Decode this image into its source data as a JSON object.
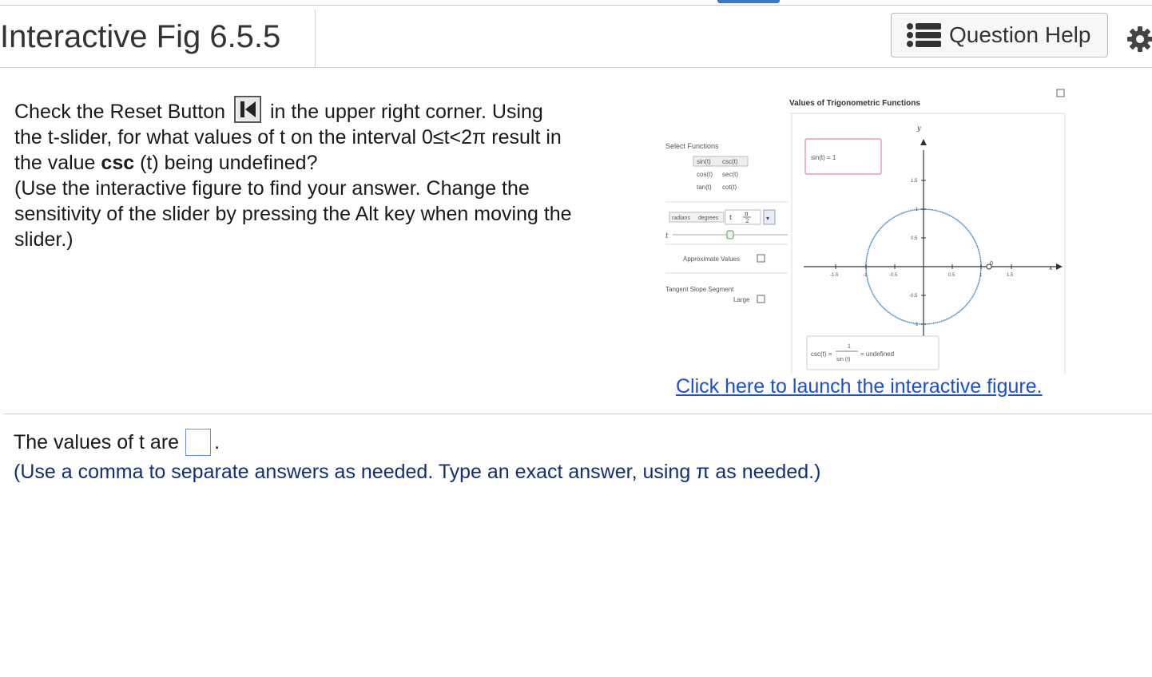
{
  "header": {
    "title": "Interactive Fig 6.5.5",
    "help_label": "Question Help"
  },
  "question": {
    "part1": "Check the Reset Button",
    "part2": "in the upper right corner. Using the t-slider, for what values of t on the interval 0≤t<2π result in the value",
    "bold_csc": "csc",
    "part3": "(t) being undefined?",
    "part4": "(Use the interactive figure to find your answer. Change the sensitivity of the slider by pressing the Alt key when moving the slider.)"
  },
  "figure": {
    "title": "Values of Trigonometric Functions",
    "select_label": "Select Functions",
    "functions": [
      "sin(t)",
      "csc(t)",
      "cos(t)",
      "sec(t)",
      "tan(t)",
      "cot(t)"
    ],
    "unit_radians": "radians",
    "unit_degrees": "degrees",
    "t_slider_label": "t",
    "t_value_num": "π",
    "t_value_den": "2",
    "approx_label": "Approximate Values",
    "tangent_label": "Tangent Slope Segment",
    "large_label": "Large",
    "sin_readout": "sin(t) = 1",
    "csc_readout_left": "csc(t) =",
    "csc_frac_num": "1",
    "csc_frac_den": "sin (t)",
    "csc_readout_right": "= undefined",
    "y_axis": "y",
    "x_axis": "x",
    "ticks_x": [
      "-1.5",
      "-1",
      "-0.5",
      "0.5",
      "1",
      "1.5"
    ],
    "ticks_y": [
      "1.5",
      "1",
      "0.5",
      "-0.5",
      "-1"
    ],
    "origin_label": "0"
  },
  "link": {
    "text": "Click here to launch the interactive figure."
  },
  "answer": {
    "prefix": "The values of t are",
    "suffix": ".",
    "hint": "(Use a comma to separate answers as needed. Type an exact answer, using π as needed.)"
  },
  "colors": {
    "accent": "#3d78c8",
    "link": "#1a4fd0",
    "hint": "#0f2f7a",
    "circle": "#4a8ab8",
    "readout_border": "#e08a9a"
  },
  "icons": {
    "help": "list-icon",
    "settings": "gear-icon",
    "reset": "reset-skip-back-icon"
  }
}
